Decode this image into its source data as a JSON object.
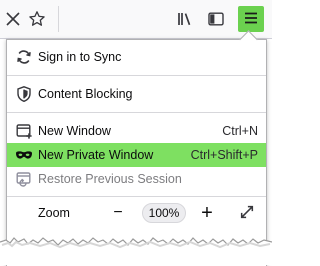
{
  "toolbar": {
    "icons": [
      "close-icon",
      "star-icon",
      "library-icon",
      "sidebar-icon",
      "hamburger-menu-icon"
    ]
  },
  "menu": {
    "sync": {
      "label": "Sign in to Sync",
      "icon": "sync-icon"
    },
    "content_blocking": {
      "label": "Content Blocking",
      "icon": "shield-icon"
    },
    "new_window": {
      "label": "New Window",
      "shortcut": "Ctrl+N",
      "icon": "new-window-icon"
    },
    "new_private_window": {
      "label": "New Private Window",
      "shortcut": "Ctrl+Shift+P",
      "icon": "private-mask-icon",
      "highlight_color": "#7ee061"
    },
    "restore_session": {
      "label": "Restore Previous Session",
      "icon": "restore-session-icon"
    },
    "zoom": {
      "label": "Zoom",
      "value": "100%",
      "decrease": "−",
      "increase": "+"
    }
  },
  "colors": {
    "menu_button": "#6bd14f",
    "highlight": "#7ee061"
  }
}
